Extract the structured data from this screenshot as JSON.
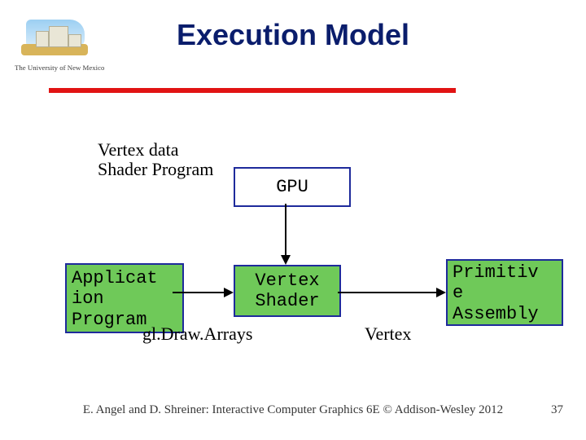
{
  "header": {
    "title": "Execution Model",
    "logo_caption": "The University of New Mexico"
  },
  "diagram": {
    "label_vertex_data_l1": "Vertex data",
    "label_vertex_data_l2": "Shader Program",
    "gpu": "GPU",
    "application_l1": "Applicat",
    "application_l2": "ion",
    "application_l3": "Program",
    "vertex_shader_l1": "Vertex",
    "vertex_shader_l2": "Shader",
    "primitive_assembly_l1": "Primitiv",
    "primitive_assembly_l2": "e",
    "primitive_assembly_l3": "Assembly",
    "drawarrays": "gl.Draw.Arrays",
    "arrow_vertex": "Vertex"
  },
  "footer": "E. Angel and D. Shreiner: Interactive Computer Graphics 6E © Addison-Wesley 2012",
  "pagenum": "37"
}
